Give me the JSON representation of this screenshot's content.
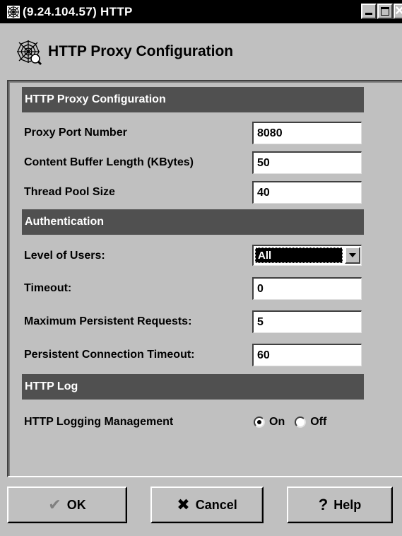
{
  "window": {
    "title": "(9.24.104.57) HTTP",
    "controls": [
      "minimize-icon",
      "maximize-icon",
      "close-icon"
    ]
  },
  "header": {
    "title": "HTTP Proxy Configuration",
    "icon": "spider-web-icon"
  },
  "sections": {
    "proxy": {
      "title": "HTTP Proxy Configuration",
      "port_label": "Proxy Port Number",
      "port_value": "8080",
      "buffer_label": "Content Buffer Length (KBytes)",
      "buffer_value": "50",
      "pool_label": "Thread Pool Size",
      "pool_value": "40"
    },
    "auth": {
      "title": "Authentication",
      "users_label": "Level of Users:",
      "users_value": "All",
      "timeout_label": "Timeout:",
      "timeout_value": "0",
      "maxreq_label": "Maximum Persistent Requests:",
      "maxreq_value": "5",
      "pctimeout_label": "Persistent Connection Timeout:",
      "pctimeout_value": "60"
    },
    "log": {
      "title": "HTTP Log",
      "mgmt_label": "HTTP Logging Management",
      "on_label": "On",
      "off_label": "Off",
      "selected": "On"
    }
  },
  "buttons": {
    "ok": "OK",
    "cancel": "Cancel",
    "help": "Help"
  }
}
